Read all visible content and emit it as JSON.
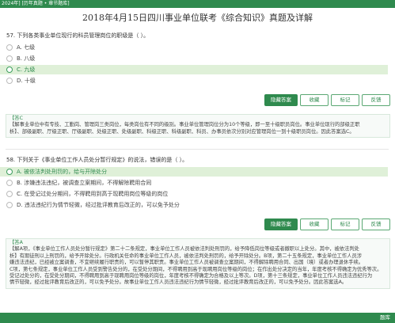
{
  "header": {
    "breadcrumb": "2024年] [历年真题 • 章节题库]"
  },
  "page_title": "2018年4月15日四川事业单位联考《综合知识》真题及详解",
  "questions": [
    {
      "text": "57. 下列各类事业单位现行的科员管理岗位的职级是（    ）。",
      "options": [
        {
          "label": "A. 七级"
        },
        {
          "label": "B. 八级"
        },
        {
          "label": "C. 九级"
        },
        {
          "label": "D. 十级"
        }
      ],
      "answer_tag": "【答C",
      "explanation_lines": [
        "【解事业单位中有专技、工勤岗、管理岗三类岗位，每类岗位有不同的级别。事业单位管理岗位分为10个等级，即一至十级职员岗位。事业单位现行的部级正职",
        "析】、部级副职、厅级正职、厅级副职、处级正职、处级副职、科级正职、科级副职、科员、办事员依次分别对应管理岗位一到十级职员岗位。因此答案选C。"
      ]
    },
    {
      "text": "58. 下列关于《事业单位工作人员处分暂行规定》的说法，错误的是（    ）。",
      "options": [
        {
          "label": "A. 被依法判处刑罚的，给与开除处分"
        },
        {
          "label": "B. 涉嫌违法违纪，被调查立案期间，不得解除聘用合同"
        },
        {
          "label": "C. 在受记过处分期间，不得聘用到高于现聘用岗位等级的岗位"
        },
        {
          "label": "D. 违法违纪行为情节轻微，经过批评教育后改正的，可以免予处分"
        }
      ],
      "answer_tag": "【答A",
      "explanation_lines": [
        "【解A项，《事业单位工作人员处分暂行规定》第二十二条规定，事业单位工作人员被依法判处刑罚的，给予降低岗位等级或者撤职以上处分。其中，被依法判处",
        "析】有期徒刑以上刑罚的，给予开除处分。行政机关任命的事业单位工作人员，被依法判处刑罚的，给予开除处分。B项，第二十五条规定，事业单位工作人员涉",
        "嫌违法违纪，已经被立案调查，不宜继续履行职责的，可以暂停其职责。事业单位工作人员被调查立案期间，不得解除聘用合同、出国（境）或者办理退休手续。",
        "C项，第七条规定，事业单位工作人员受到警告处分的，在受处分期间，不得聘用到高于现聘用岗位等级的岗位；在作出处分决定的当年，年度考核不得确定为优秀等次。",
        "受记过处分的，在受处分期间，不得聘用到高于现聘用岗位等级的岗位，年度考核不得确定为合格及以上等次。D项，第十三条规定，事业单位工作人员违法违纪行为",
        "情节轻微，经过批评教育后改正的，可以免予处分。故事业单位工作人员违法违纪行为情节轻微，经过批评教育后改正的，可以免予处分。因此答案选A。"
      ]
    }
  ],
  "buttons": {
    "hide_answer": "隐藏答案",
    "favorite": "收藏",
    "mark": "标记",
    "feedback": "反馈"
  },
  "footer": {
    "brand": "题库"
  },
  "colors": {
    "accent": "#2f8a4e",
    "selected_bg": "#dff0d8"
  }
}
